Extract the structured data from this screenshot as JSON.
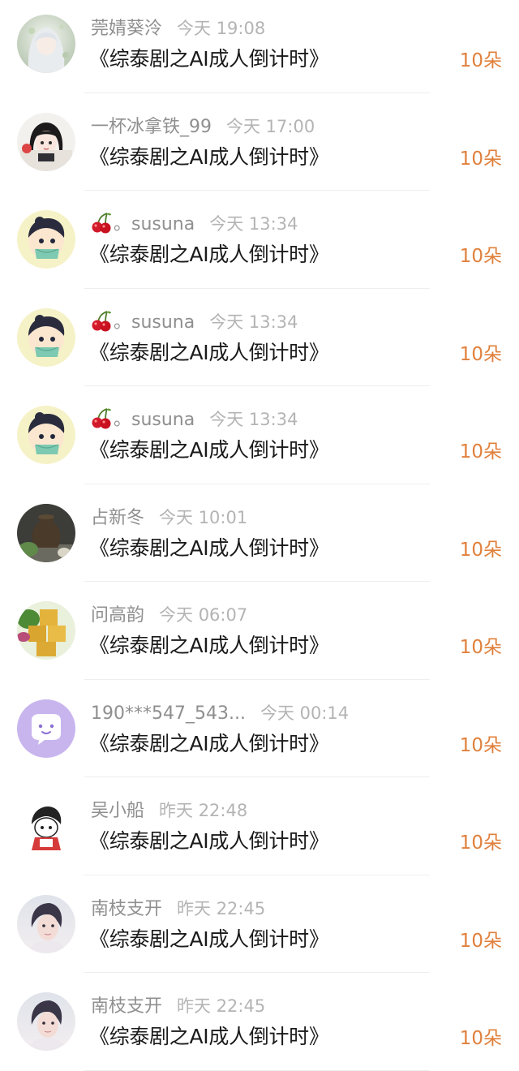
{
  "rows": [
    {
      "username": "莞婧葵泠",
      "cherry": false,
      "time": "今天 19:08",
      "title": "《综泰剧之AI成人倒计时》",
      "gift": "10朵",
      "avatar": "anime-girl-white-hair"
    },
    {
      "username": "一杯冰拿铁_99",
      "cherry": false,
      "time": "今天 17:00",
      "title": "《综泰剧之AI成人倒计时》",
      "gift": "10朵",
      "avatar": "anime-girl-black-hair"
    },
    {
      "username": "。susuna",
      "cherry": true,
      "time": "今天 13:34",
      "title": "《综泰剧之AI成人倒计时》",
      "gift": "10朵",
      "avatar": "chibi-boy-mask"
    },
    {
      "username": "。susuna",
      "cherry": true,
      "time": "今天 13:34",
      "title": "《综泰剧之AI成人倒计时》",
      "gift": "10朵",
      "avatar": "chibi-boy-mask"
    },
    {
      "username": "。susuna",
      "cherry": true,
      "time": "今天 13:34",
      "title": "《综泰剧之AI成人倒计时》",
      "gift": "10朵",
      "avatar": "chibi-boy-mask"
    },
    {
      "username": "占新冬",
      "cherry": false,
      "time": "今天 10:01",
      "title": "《综泰剧之AI成人倒计时》",
      "gift": "10朵",
      "avatar": "dark-vase"
    },
    {
      "username": "问高韵",
      "cherry": false,
      "time": "今天 06:07",
      "title": "《综泰剧之AI成人倒计时》",
      "gift": "10朵",
      "avatar": "yellow-cake"
    },
    {
      "username": "190***547_543...",
      "cherry": false,
      "time": "今天 00:14",
      "title": "《综泰剧之AI成人倒计时》",
      "gift": "10朵",
      "avatar": "purple-chat-bubble"
    },
    {
      "username": "吴小船",
      "cherry": false,
      "time": "昨天 22:48",
      "title": "《综泰剧之AI成人倒计时》",
      "gift": "10朵",
      "avatar": "chibi-sketch"
    },
    {
      "username": "南枝支开",
      "cherry": false,
      "time": "昨天 22:45",
      "title": "《综泰剧之AI成人倒计时》",
      "gift": "10朵",
      "avatar": "portrait-man"
    },
    {
      "username": "南枝支开",
      "cherry": false,
      "time": "昨天 22:45",
      "title": "《综泰剧之AI成人倒计时》",
      "gift": "10朵",
      "avatar": "portrait-man"
    }
  ],
  "colors": {
    "username": "#8f8f8f",
    "time": "#b4b4b4",
    "title": "#1a1a1a",
    "gift": "#e0803c",
    "divider": "#eeeeee"
  }
}
